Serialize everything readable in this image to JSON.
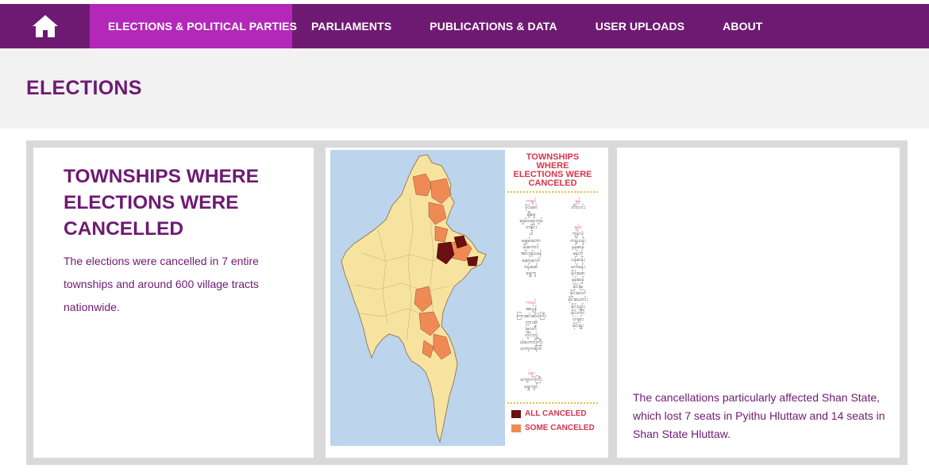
{
  "nav": {
    "home_icon": "home-icon",
    "items": [
      {
        "label": "ELECTIONS & POLITICAL PARTIES",
        "active": true
      },
      {
        "label": "PARLIAMENTS"
      },
      {
        "label": "PUBLICATIONS & DATA"
      },
      {
        "label": "USER UPLOADS"
      },
      {
        "label": "ABOUT"
      }
    ]
  },
  "page": {
    "title": "ELECTIONS"
  },
  "card1": {
    "heading": "TOWNSHIPS WHERE ELECTIONS WERE CANCELLED",
    "body": "The elections were cancelled in 7 entire townships and around 600 village tracts nationwide."
  },
  "map": {
    "title_line1": "TOWNSHIPS",
    "title_line2": "WHERE",
    "title_line3": "ELECTIONS WERE",
    "title_line4": "CANCELED",
    "legend_all": "ALL CANCELED",
    "legend_some": "SOME CANCELED",
    "colors": {
      "all": "#6b0f0f",
      "some": "#f08a55",
      "land": "#f7e3a0",
      "water": "#bcd4ec"
    },
    "list_left_1": [
      "ကချင်",
      "ပိုင်မော်",
      "ချီဖွေ",
      "ဆွမ်းပရာဘွမ်",
      "တနိုင်း",
      "ပါ",
      "မချမ်းဘော",
      "မိုးကောင်",
      "အင်ဂျန်းယန်",
      "ဆော့လော်",
      "ဗန်းမော်",
      "ရွှေကူ"
    ],
    "list_left_2": [
      "ကရင်",
      "အာပွန်",
      "ကြာအင်းဆိပ်ကြီး",
      "ဘားအံ",
      "မြဝတီ",
      "လှိုင်းဘွဲ့",
      "သံတောင်ကြီး",
      "ကော့ကရိတ်"
    ],
    "list_left_3": [
      "ပဲခူး",
      "ကျောက်ကြီး",
      "ရွှေကျင်"
    ],
    "list_right_1": [
      "မွန်",
      "ဘီးလင်း"
    ],
    "list_right_2": [
      "ရှမ်း",
      "ကွန်လုံ",
      "တန့်ယန်း",
      "နမ့်ဆန်",
      "မန်တုံ",
      "ပန်ဆန်း",
      "မက်မန်း",
      "မိုင်းမော",
      "နမ့်ဆန်",
      "မိုင်းမြ",
      "မိုင်းဆတ်",
      "မိုင်းယောင်း",
      "မိုင်းပျဉ်း",
      "မိုင်းကိုင်",
      "လဲချား",
      "မိုင်းရှူး"
    ]
  },
  "card3": {
    "body": "The cancellations particularly affected Shan State, which lost 7 seats in Pyithu Hluttaw and 14 seats in Shan State Hluttaw."
  }
}
